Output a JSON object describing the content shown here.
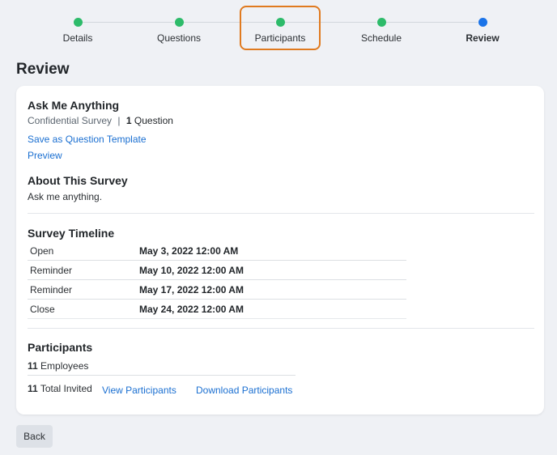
{
  "stepper": {
    "steps": [
      {
        "label": "Details"
      },
      {
        "label": "Questions"
      },
      {
        "label": "Participants"
      },
      {
        "label": "Schedule"
      },
      {
        "label": "Review"
      }
    ]
  },
  "page_title": "Review",
  "survey": {
    "name": "Ask Me Anything",
    "type": "Confidential Survey",
    "separator": "|",
    "question_count": "1",
    "question_label": "Question",
    "save_template_link": "Save as Question Template",
    "preview_link": "Preview"
  },
  "about": {
    "heading": "About This Survey",
    "text": "Ask me anything."
  },
  "timeline": {
    "heading": "Survey Timeline",
    "rows": [
      {
        "label": "Open",
        "value": "May 3, 2022 12:00 AM"
      },
      {
        "label": "Reminder",
        "value": "May 10, 2022 12:00 AM"
      },
      {
        "label": "Reminder",
        "value": "May 17, 2022 12:00 AM"
      },
      {
        "label": "Close",
        "value": "May 24, 2022 12:00 AM"
      }
    ]
  },
  "participants": {
    "heading": "Participants",
    "employees_count": "11",
    "employees_label": "Employees",
    "invited_count": "11",
    "invited_label": "Total Invited",
    "view_link": "View Participants",
    "download_link": "Download Participants"
  },
  "footer": {
    "back_label": "Back"
  },
  "colors": {
    "complete": "#2dbb6a",
    "current": "#1a73e8",
    "highlight": "#e07a1f",
    "link": "#1a6fd1"
  }
}
